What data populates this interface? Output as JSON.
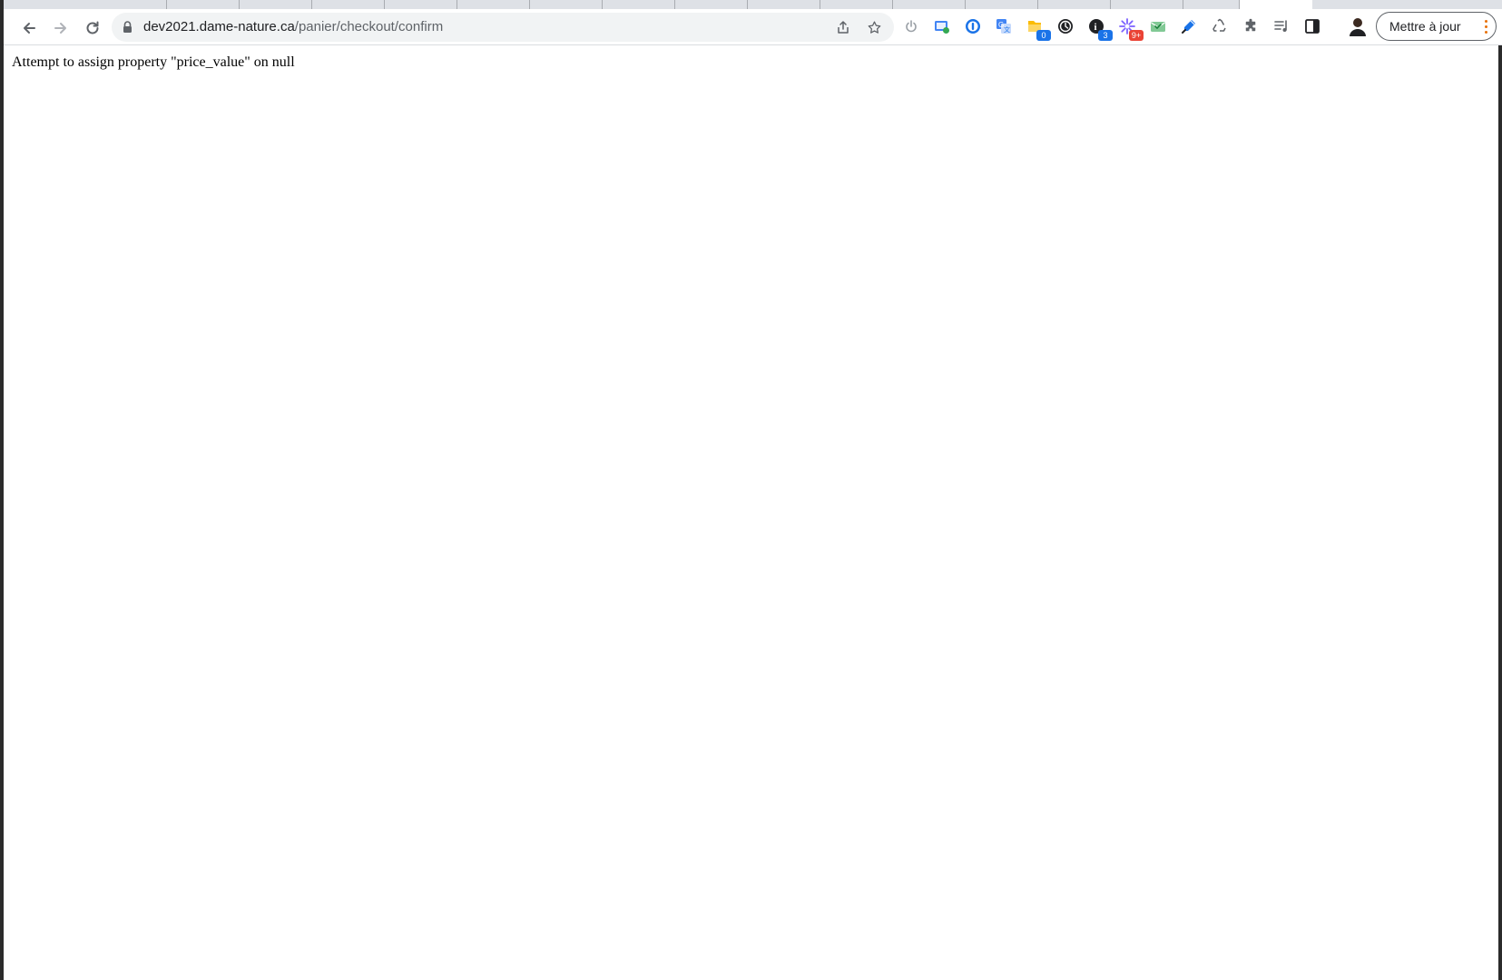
{
  "browser": {
    "url_host": "dev2021.dame-nature.ca",
    "url_path": "/panier/checkout/confirm",
    "update_button_label": "Mettre à jour",
    "extensions": [
      {
        "name": "power-icon"
      },
      {
        "name": "screen-capture-icon"
      },
      {
        "name": "password-manager-icon"
      },
      {
        "name": "translate-icon"
      },
      {
        "name": "notes-icon",
        "badge": "0",
        "badge_color": "#1a73e8"
      },
      {
        "name": "timer-icon"
      },
      {
        "name": "info-icon",
        "badge": "3",
        "badge_color": "#1a73e8"
      },
      {
        "name": "sparkle-icon",
        "badge": "9+",
        "badge_color": "#ea4335"
      },
      {
        "name": "mail-check-icon"
      },
      {
        "name": "highlighter-icon"
      },
      {
        "name": "recycle-icon"
      },
      {
        "name": "puzzle-icon"
      },
      {
        "name": "media-queue-icon"
      },
      {
        "name": "side-panel-icon"
      },
      {
        "name": "avatar"
      }
    ]
  },
  "page": {
    "error_message": "Attempt to assign property \"price_value\" on null"
  },
  "colors": {
    "accent": "#1a73e8",
    "kebab": "#e8710a"
  }
}
